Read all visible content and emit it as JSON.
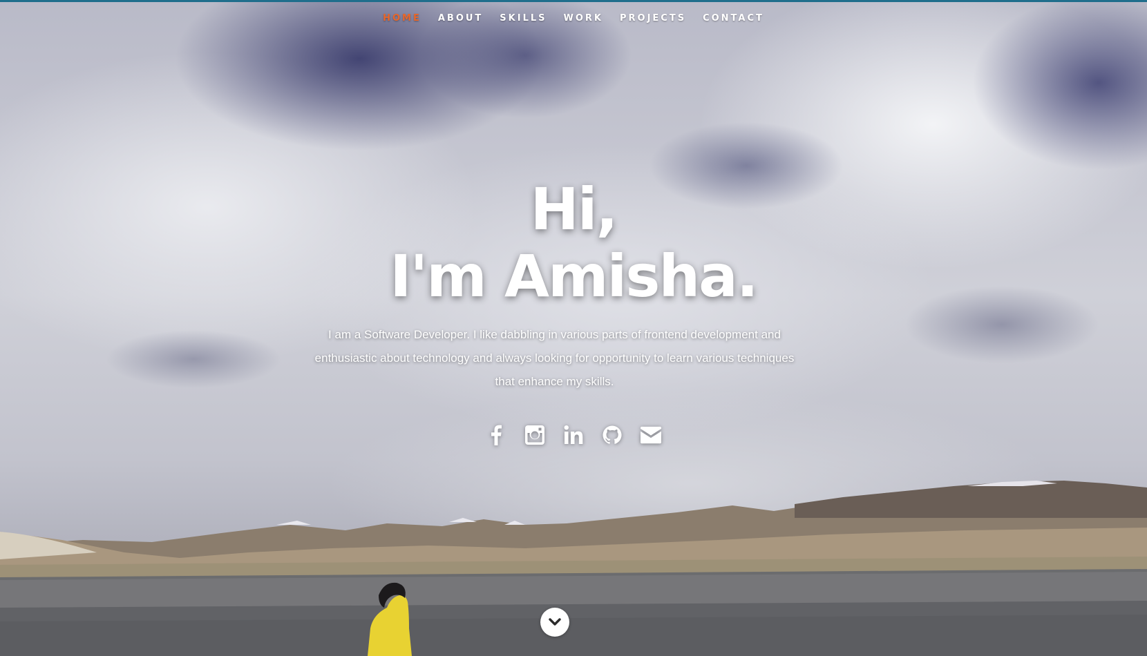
{
  "nav": {
    "items": [
      {
        "label": "HOME",
        "active": true
      },
      {
        "label": "ABOUT",
        "active": false
      },
      {
        "label": "SKILLS",
        "active": false
      },
      {
        "label": "WORK",
        "active": false
      },
      {
        "label": "PROJECTS",
        "active": false
      },
      {
        "label": "CONTACT",
        "active": false
      }
    ],
    "active_color": "#e8662a",
    "top_bar_color": "#1f6e8c"
  },
  "hero": {
    "greeting": "Hi,",
    "name_line": "I'm Amisha.",
    "intro": "I am a Software Developer. I like dabbling in various parts of frontend development and enthusiastic about technology and always looking for opportunity to learn various techniques that enhance my skills."
  },
  "social": {
    "icons": [
      "facebook-icon",
      "instagram-icon",
      "linkedin-icon",
      "github-icon",
      "envelope-icon"
    ]
  },
  "scroll_down": {
    "icon": "chevron-down-icon"
  }
}
